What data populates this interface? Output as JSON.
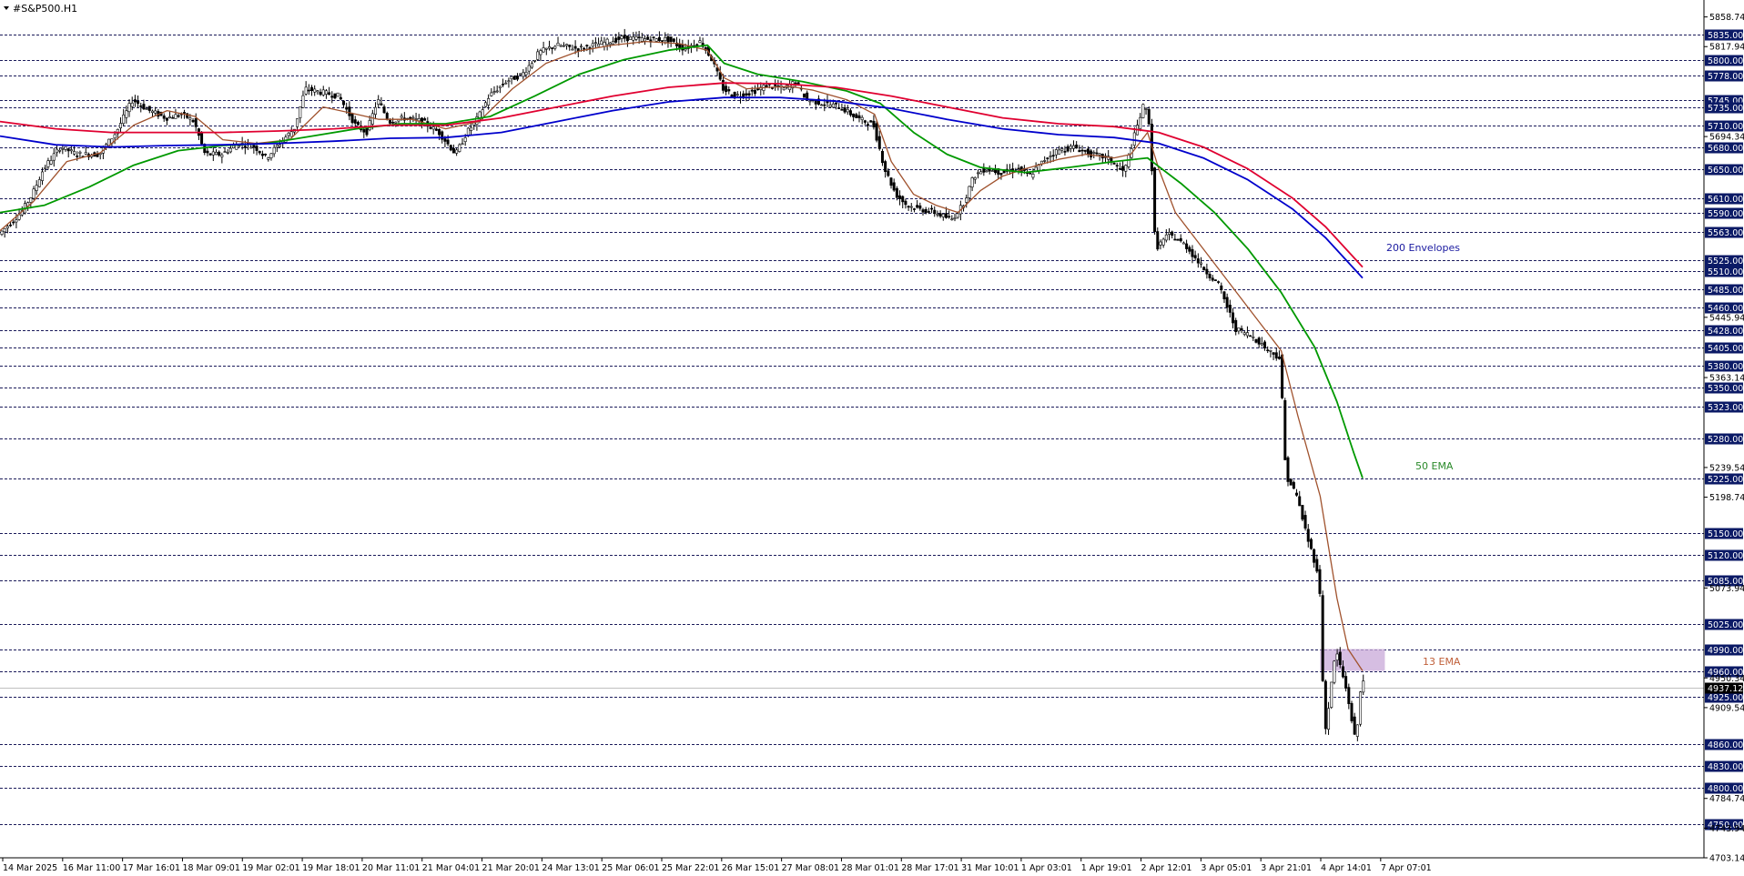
{
  "window": {
    "symbol_title": "#S&P500.H1",
    "current_price": "4937.12"
  },
  "colors": {
    "background": "#ffffff",
    "candle": "#000000",
    "ema13": "#a0522d",
    "ema50": "#009900",
    "env_upper": "#e00030",
    "env_lower": "#0000cc",
    "level_line": "#1a1a5a",
    "level_label_bg": "#0b1a66",
    "highlight_zone": "#c8a8d8"
  },
  "annotations": {
    "envelopes": "200 Envelopes",
    "ema50": "50 EMA",
    "ema13": "13 EMA"
  },
  "chart_data": {
    "type": "candlestick",
    "title": "#S&P500.H1",
    "ylim": [
      4703.14,
      5872
    ],
    "y_scale_ticks": [
      "5858.74",
      "5817.94",
      "5694.34",
      "5445.94",
      "5363.14",
      "5239.54",
      "5198.74",
      "5073.94",
      "4950.34",
      "4909.54",
      "4784.74",
      "4743.94",
      "4703.14"
    ],
    "support_resistance_levels": [
      "5835.00",
      "5800.00",
      "5778.00",
      "5745.00",
      "5735.00",
      "5710.00",
      "5680.00",
      "5650.00",
      "5610.00",
      "5590.00",
      "5563.00",
      "5525.00",
      "5510.00",
      "5485.00",
      "5460.00",
      "5428.00",
      "5405.00",
      "5380.00",
      "5350.00",
      "5323.00",
      "5280.00",
      "5225.00",
      "5150.00",
      "5120.00",
      "5085.00",
      "5025.00",
      "4990.00",
      "4960.00",
      "4925.00",
      "4860.00",
      "4830.00",
      "4800.00",
      "4750.00"
    ],
    "x_ticks": [
      "14 Mar 2025",
      "16 Mar 11:00",
      "17 Mar 16:01",
      "18 Mar 09:01",
      "19 Mar 02:01",
      "19 Mar 18:01",
      "20 Mar 11:01",
      "21 Mar 04:01",
      "21 Mar 20:01",
      "24 Mar 13:01",
      "25 Mar 06:01",
      "25 Mar 22:01",
      "26 Mar 15:01",
      "27 Mar 08:01",
      "28 Mar 01:01",
      "28 Mar 17:01",
      "31 Mar 10:01",
      "1 Apr 03:01",
      "1 Apr 19:01",
      "2 Apr 12:01",
      "3 Apr 05:01",
      "3 Apr 21:01",
      "4 Apr 14:01",
      "7 Apr 07:01"
    ],
    "price_path": [
      [
        0,
        5560
      ],
      [
        10,
        5575
      ],
      [
        20,
        5590
      ],
      [
        30,
        5615
      ],
      [
        40,
        5650
      ],
      [
        55,
        5680
      ],
      [
        70,
        5670
      ],
      [
        90,
        5670
      ],
      [
        105,
        5700
      ],
      [
        120,
        5745
      ],
      [
        135,
        5730
      ],
      [
        150,
        5720
      ],
      [
        165,
        5725
      ],
      [
        175,
        5715
      ],
      [
        185,
        5670
      ],
      [
        200,
        5670
      ],
      [
        215,
        5685
      ],
      [
        230,
        5680
      ],
      [
        240,
        5665
      ],
      [
        255,
        5690
      ],
      [
        265,
        5705
      ],
      [
        275,
        5760
      ],
      [
        290,
        5755
      ],
      [
        305,
        5750
      ],
      [
        320,
        5710
      ],
      [
        330,
        5700
      ],
      [
        340,
        5745
      ],
      [
        350,
        5715
      ],
      [
        365,
        5720
      ],
      [
        380,
        5715
      ],
      [
        395,
        5700
      ],
      [
        410,
        5670
      ],
      [
        420,
        5700
      ],
      [
        430,
        5720
      ],
      [
        440,
        5750
      ],
      [
        455,
        5770
      ],
      [
        470,
        5780
      ],
      [
        485,
        5810
      ],
      [
        500,
        5820
      ],
      [
        520,
        5815
      ],
      [
        540,
        5822
      ],
      [
        560,
        5830
      ],
      [
        580,
        5828
      ],
      [
        600,
        5828
      ],
      [
        615,
        5815
      ],
      [
        630,
        5825
      ],
      [
        640,
        5800
      ],
      [
        650,
        5760
      ],
      [
        660,
        5750
      ],
      [
        675,
        5755
      ],
      [
        690,
        5765
      ],
      [
        705,
        5760
      ],
      [
        715,
        5770
      ],
      [
        725,
        5745
      ],
      [
        740,
        5740
      ],
      [
        755,
        5735
      ],
      [
        770,
        5720
      ],
      [
        785,
        5710
      ],
      [
        795,
        5650
      ],
      [
        805,
        5615
      ],
      [
        815,
        5600
      ],
      [
        825,
        5595
      ],
      [
        840,
        5590
      ],
      [
        855,
        5580
      ],
      [
        865,
        5600
      ],
      [
        875,
        5640
      ],
      [
        885,
        5650
      ],
      [
        900,
        5645
      ],
      [
        915,
        5650
      ],
      [
        925,
        5640
      ],
      [
        940,
        5665
      ],
      [
        950,
        5675
      ],
      [
        965,
        5680
      ],
      [
        980,
        5670
      ],
      [
        995,
        5665
      ],
      [
        1010,
        5645
      ],
      [
        1020,
        5700
      ],
      [
        1028,
        5740
      ],
      [
        1033,
        5710
      ],
      [
        1038,
        5540
      ],
      [
        1050,
        5560
      ],
      [
        1065,
        5545
      ],
      [
        1080,
        5515
      ],
      [
        1095,
        5490
      ],
      [
        1110,
        5430
      ],
      [
        1125,
        5420
      ],
      [
        1140,
        5400
      ],
      [
        1150,
        5390
      ],
      [
        1155,
        5230
      ],
      [
        1165,
        5200
      ],
      [
        1175,
        5140
      ],
      [
        1185,
        5090
      ],
      [
        1190,
        4870
      ],
      [
        1200,
        4990
      ],
      [
        1210,
        4930
      ],
      [
        1218,
        4860
      ],
      [
        1223,
        4950
      ]
    ],
    "series": [
      {
        "name": "13 EMA",
        "points": [
          [
            0,
            5565
          ],
          [
            30,
            5605
          ],
          [
            60,
            5660
          ],
          [
            90,
            5672
          ],
          [
            120,
            5710
          ],
          [
            150,
            5730
          ],
          [
            175,
            5722
          ],
          [
            200,
            5690
          ],
          [
            230,
            5685
          ],
          [
            260,
            5690
          ],
          [
            290,
            5735
          ],
          [
            320,
            5725
          ],
          [
            340,
            5718
          ],
          [
            370,
            5718
          ],
          [
            400,
            5705
          ],
          [
            430,
            5715
          ],
          [
            460,
            5760
          ],
          [
            490,
            5795
          ],
          [
            520,
            5812
          ],
          [
            550,
            5820
          ],
          [
            580,
            5825
          ],
          [
            610,
            5822
          ],
          [
            635,
            5813
          ],
          [
            650,
            5775
          ],
          [
            670,
            5760
          ],
          [
            690,
            5762
          ],
          [
            710,
            5763
          ],
          [
            730,
            5758
          ],
          [
            760,
            5745
          ],
          [
            785,
            5725
          ],
          [
            800,
            5660
          ],
          [
            820,
            5615
          ],
          [
            840,
            5600
          ],
          [
            860,
            5590
          ],
          [
            880,
            5620
          ],
          [
            900,
            5640
          ],
          [
            920,
            5650
          ],
          [
            950,
            5663
          ],
          [
            975,
            5670
          ],
          [
            1000,
            5665
          ],
          [
            1015,
            5670
          ],
          [
            1030,
            5700
          ],
          [
            1040,
            5650
          ],
          [
            1055,
            5590
          ],
          [
            1075,
            5550
          ],
          [
            1095,
            5510
          ],
          [
            1110,
            5480
          ],
          [
            1130,
            5440
          ],
          [
            1150,
            5400
          ],
          [
            1165,
            5310
          ],
          [
            1185,
            5200
          ],
          [
            1200,
            5060
          ],
          [
            1210,
            4990
          ],
          [
            1223,
            4960
          ]
        ]
      },
      {
        "name": "50 EMA",
        "points": [
          [
            0,
            5590
          ],
          [
            40,
            5600
          ],
          [
            80,
            5625
          ],
          [
            120,
            5655
          ],
          [
            160,
            5675
          ],
          [
            200,
            5682
          ],
          [
            240,
            5685
          ],
          [
            280,
            5695
          ],
          [
            320,
            5705
          ],
          [
            360,
            5712
          ],
          [
            400,
            5712
          ],
          [
            440,
            5722
          ],
          [
            480,
            5750
          ],
          [
            520,
            5780
          ],
          [
            560,
            5800
          ],
          [
            600,
            5813
          ],
          [
            635,
            5820
          ],
          [
            650,
            5795
          ],
          [
            680,
            5780
          ],
          [
            720,
            5770
          ],
          [
            760,
            5757
          ],
          [
            790,
            5740
          ],
          [
            820,
            5700
          ],
          [
            850,
            5670
          ],
          [
            880,
            5652
          ],
          [
            920,
            5645
          ],
          [
            960,
            5652
          ],
          [
            1000,
            5660
          ],
          [
            1030,
            5665
          ],
          [
            1060,
            5630
          ],
          [
            1090,
            5590
          ],
          [
            1120,
            5540
          ],
          [
            1150,
            5480
          ],
          [
            1180,
            5405
          ],
          [
            1200,
            5330
          ],
          [
            1215,
            5260
          ],
          [
            1223,
            5225
          ]
        ]
      },
      {
        "name": "200 Envelopes upper",
        "points": [
          [
            0,
            5715
          ],
          [
            50,
            5705
          ],
          [
            100,
            5700
          ],
          [
            150,
            5700
          ],
          [
            200,
            5700
          ],
          [
            250,
            5702
          ],
          [
            300,
            5705
          ],
          [
            350,
            5710
          ],
          [
            400,
            5710
          ],
          [
            450,
            5720
          ],
          [
            500,
            5735
          ],
          [
            550,
            5750
          ],
          [
            600,
            5762
          ],
          [
            650,
            5768
          ],
          [
            700,
            5767
          ],
          [
            750,
            5762
          ],
          [
            800,
            5750
          ],
          [
            850,
            5735
          ],
          [
            900,
            5720
          ],
          [
            950,
            5712
          ],
          [
            1000,
            5708
          ],
          [
            1040,
            5700
          ],
          [
            1080,
            5680
          ],
          [
            1120,
            5650
          ],
          [
            1160,
            5610
          ],
          [
            1190,
            5570
          ],
          [
            1223,
            5515
          ]
        ]
      },
      {
        "name": "200 Envelopes lower",
        "points": [
          [
            0,
            5695
          ],
          [
            50,
            5683
          ],
          [
            100,
            5680
          ],
          [
            150,
            5682
          ],
          [
            200,
            5683
          ],
          [
            250,
            5685
          ],
          [
            300,
            5688
          ],
          [
            350,
            5692
          ],
          [
            400,
            5693
          ],
          [
            450,
            5700
          ],
          [
            500,
            5715
          ],
          [
            550,
            5730
          ],
          [
            600,
            5742
          ],
          [
            650,
            5748
          ],
          [
            700,
            5748
          ],
          [
            750,
            5743
          ],
          [
            800,
            5733
          ],
          [
            850,
            5718
          ],
          [
            900,
            5705
          ],
          [
            950,
            5697
          ],
          [
            1000,
            5693
          ],
          [
            1040,
            5685
          ],
          [
            1080,
            5665
          ],
          [
            1120,
            5635
          ],
          [
            1160,
            5595
          ],
          [
            1190,
            5555
          ],
          [
            1223,
            5500
          ]
        ]
      }
    ],
    "highlight_zone": {
      "price_from": 4960,
      "price_to": 4990,
      "bar_from": 1185,
      "bar_to": 1243
    }
  }
}
